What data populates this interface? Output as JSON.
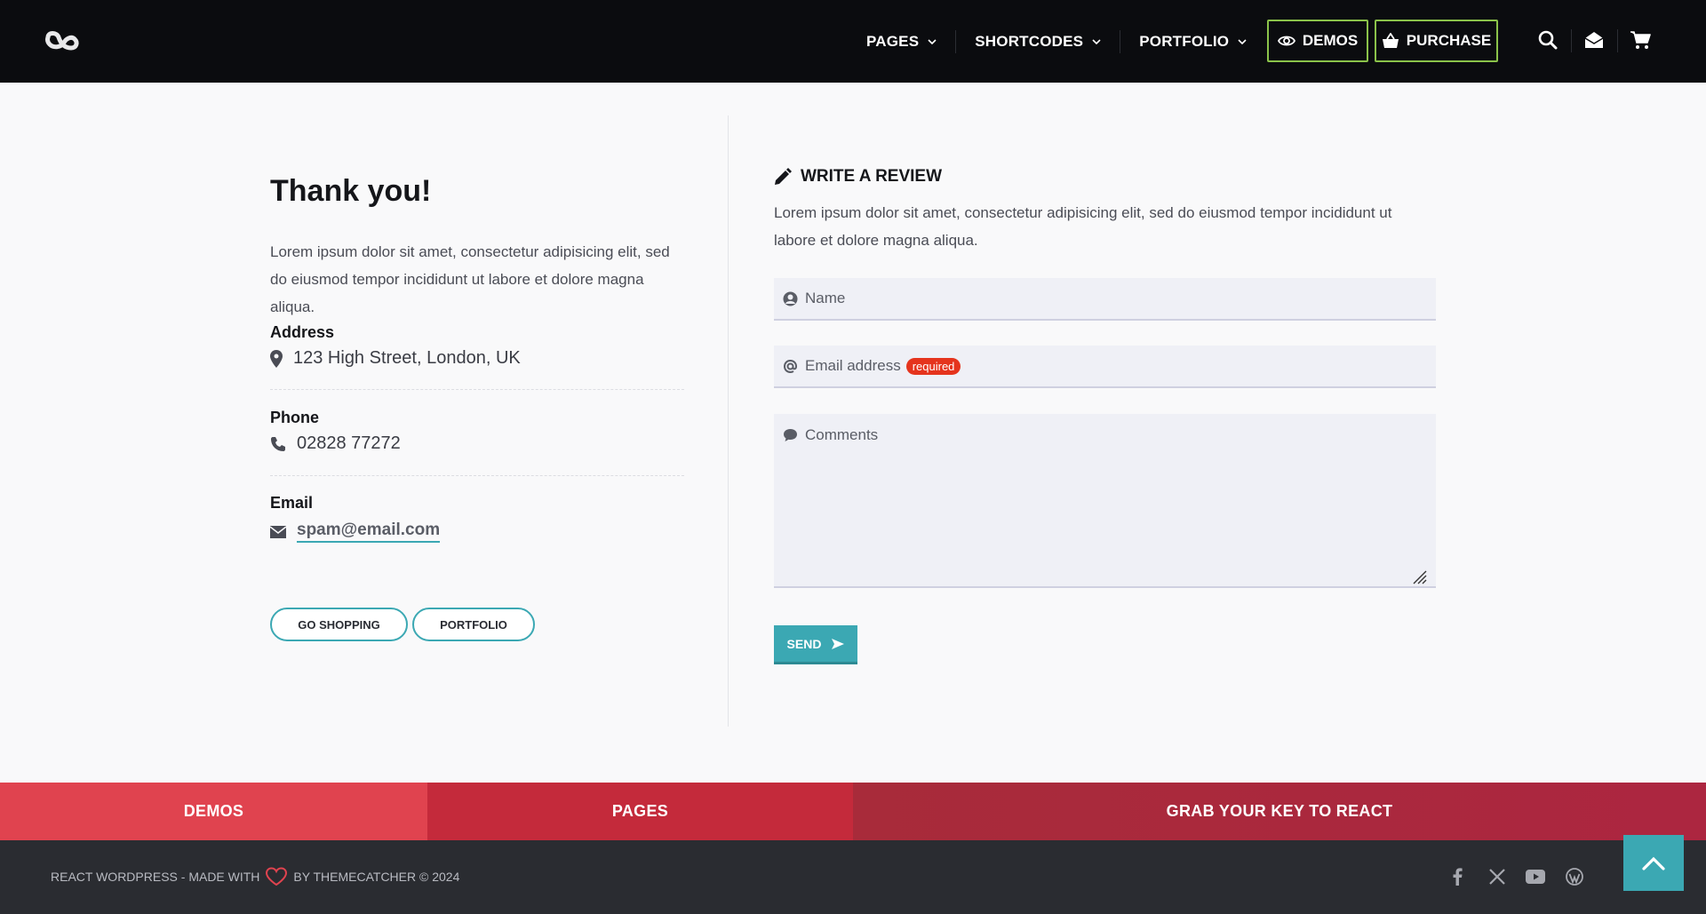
{
  "header": {
    "nav": [
      {
        "label": "PAGES"
      },
      {
        "label": "SHORTCODES"
      },
      {
        "label": "PORTFOLIO"
      }
    ],
    "demos_label": "DEMOS",
    "purchase_label": "PURCHASE",
    "accent_color": "#8bc34a"
  },
  "contact": {
    "title": "Thank you!",
    "lead": "Lorem ipsum dolor sit amet, consectetur adipisicing elit, sed do eiusmod tempor incididunt ut labore et dolore magna aliqua.",
    "address_label": "Address",
    "address_value": "123 High Street, London, UK",
    "phone_label": "Phone",
    "phone_value": "02828 77272",
    "email_label": "Email",
    "email_value": "spam@email.com",
    "buttons": {
      "shopping": "GO SHOPPING",
      "portfolio": "PORTFOLIO"
    }
  },
  "review": {
    "heading": "WRITE A REVIEW",
    "lead": "Lorem ipsum dolor sit amet, consectetur adipisicing elit, sed do eiusmod tempor incididunt ut labore et dolore magna aliqua.",
    "name_placeholder": "Name",
    "email_placeholder": "Email address",
    "required_badge": "required",
    "comments_placeholder": "Comments",
    "send_label": "SEND",
    "accent_color": "#3ba8b3"
  },
  "footer_bar": {
    "demos": "DEMOS",
    "pages": "PAGES",
    "key": "GRAB YOUR KEY TO REACT"
  },
  "footer": {
    "copy_pre": "REACT WORDPRESS - MADE WITH",
    "copy_post": "BY THEMECATCHER © 2024",
    "social": [
      "facebook-icon",
      "x-icon",
      "youtube-icon",
      "wordpress-icon"
    ]
  }
}
